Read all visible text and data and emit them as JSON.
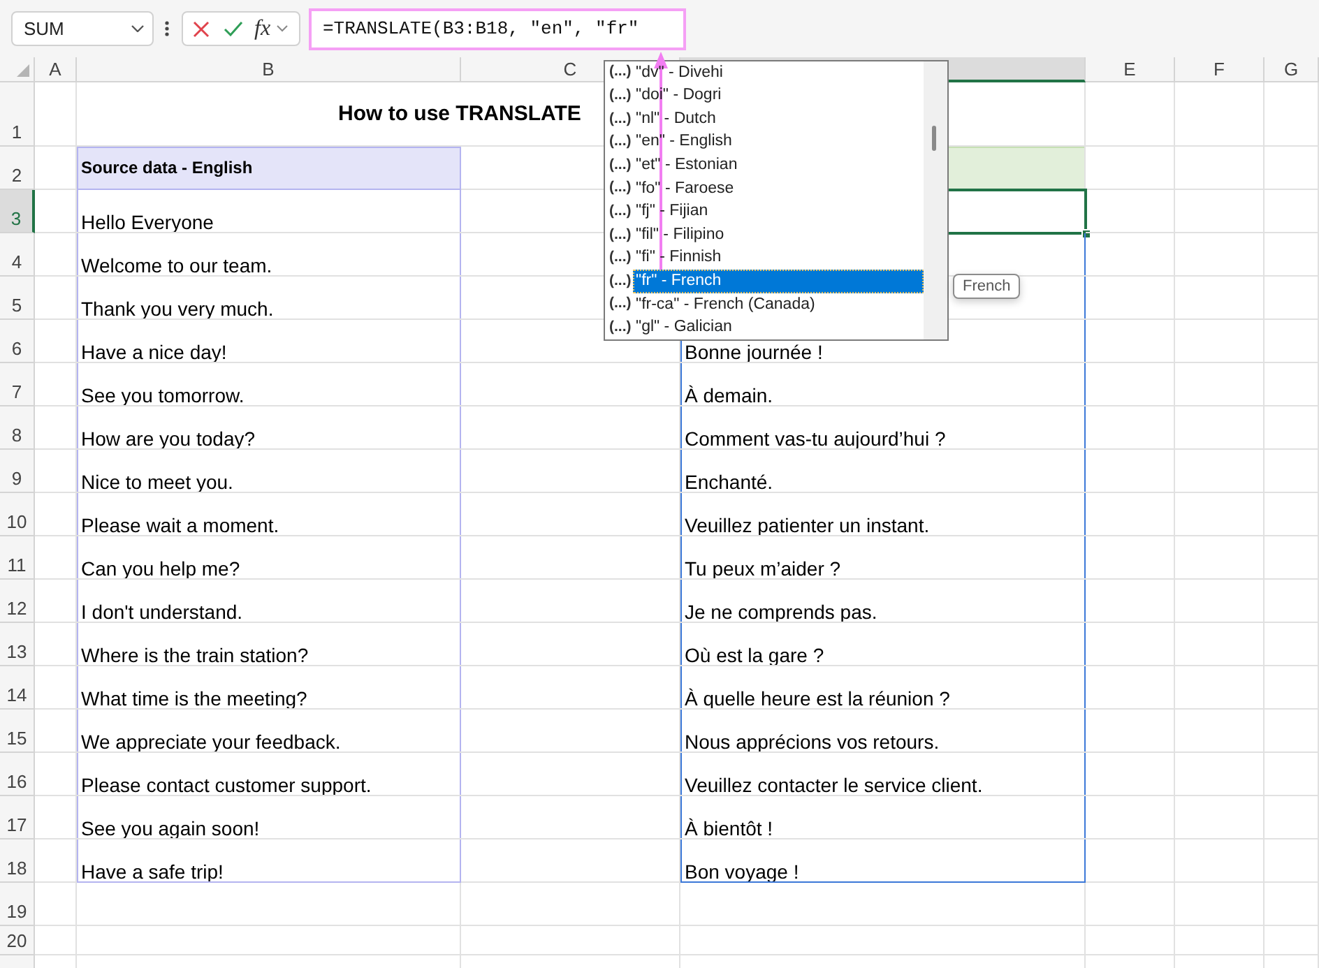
{
  "name_box": {
    "value": "SUM"
  },
  "formula_bar": {
    "function_label": "fx",
    "formula": "=TRANSLATE(B3:B18, \"en\", \"fr\""
  },
  "columns": [
    {
      "label": "A",
      "selected": false
    },
    {
      "label": "B",
      "selected": false
    },
    {
      "label": "C",
      "selected": false
    },
    {
      "selected": true
    },
    {
      "label": "E",
      "selected": false
    },
    {
      "label": "F",
      "selected": false
    },
    {
      "label": "G",
      "selected": false
    }
  ],
  "rows": [
    {
      "label": "1",
      "selected": false,
      "kind": "title",
      "title": "How to use TRANSLATE"
    },
    {
      "label": "2",
      "selected": false,
      "kind": "header",
      "source": "Source data - English"
    },
    {
      "label": "3",
      "selected": true,
      "kind": "data",
      "source": "Hello Everyone"
    },
    {
      "label": "4",
      "selected": false,
      "kind": "data",
      "source": "Welcome to our team."
    },
    {
      "label": "5",
      "selected": false,
      "kind": "data",
      "source": "Thank you very much."
    },
    {
      "label": "6",
      "selected": false,
      "kind": "data",
      "source": "Have a nice day!",
      "result": "Bonne journée !"
    },
    {
      "label": "7",
      "selected": false,
      "kind": "data",
      "source": "See you tomorrow.",
      "result": "À demain."
    },
    {
      "label": "8",
      "selected": false,
      "kind": "data",
      "source": "How are you today?",
      "result": "Comment vas-tu aujourd’hui ?"
    },
    {
      "label": "9",
      "selected": false,
      "kind": "data",
      "source": "Nice to meet you.",
      "result": "Enchanté."
    },
    {
      "label": "10",
      "selected": false,
      "kind": "data",
      "source": "Please wait a moment.",
      "result": "Veuillez patienter un instant."
    },
    {
      "label": "11",
      "selected": false,
      "kind": "data",
      "source": "Can you help me?",
      "result": "Tu peux m’aider ?"
    },
    {
      "label": "12",
      "selected": false,
      "kind": "data",
      "source": "I don't understand.",
      "result": "Je ne comprends pas."
    },
    {
      "label": "13",
      "selected": false,
      "kind": "data",
      "source": "Where is the train station?",
      "result": "Où est la gare ?"
    },
    {
      "label": "14",
      "selected": false,
      "kind": "data",
      "source": "What time is the meeting?",
      "result": "À quelle heure est la réunion ?"
    },
    {
      "label": "15",
      "selected": false,
      "kind": "data",
      "source": "We appreciate your feedback.",
      "result": "Nous apprécions vos retours."
    },
    {
      "label": "16",
      "selected": false,
      "kind": "data",
      "source": "Please contact customer support.",
      "result": "Veuillez contacter le service client."
    },
    {
      "label": "17",
      "selected": false,
      "kind": "data",
      "source": "See you again soon!",
      "result": "À bientôt !"
    },
    {
      "label": "18",
      "selected": false,
      "kind": "data",
      "source": "Have a safe trip!",
      "result": "Bon voyage !"
    },
    {
      "label": "19",
      "selected": false,
      "kind": "data"
    },
    {
      "label": "20",
      "selected": false,
      "kind": "data"
    }
  ],
  "autocomplete": {
    "items": [
      {
        "marker": "(...)",
        "text": "\"dv\" - Divehi",
        "selected": false
      },
      {
        "marker": "(...)",
        "text": "\"doi\" - Dogri",
        "selected": false
      },
      {
        "marker": "(...)",
        "text": "\"nl\" - Dutch",
        "selected": false
      },
      {
        "marker": "(...)",
        "text": "\"en\" - English",
        "selected": false
      },
      {
        "marker": "(...)",
        "text": "\"et\" - Estonian",
        "selected": false
      },
      {
        "marker": "(...)",
        "text": "\"fo\" - Faroese",
        "selected": false
      },
      {
        "marker": "(...)",
        "text": "\"fj\" - Fijian",
        "selected": false
      },
      {
        "marker": "(...)",
        "text": "\"fil\" - Filipino",
        "selected": false
      },
      {
        "marker": "(...)",
        "text": "\"fi\" - Finnish",
        "selected": false
      },
      {
        "marker": "(...)",
        "text": "\"fr\" - French",
        "selected": true
      },
      {
        "marker": "(...)",
        "text": "\"fr-ca\" - French (Canada)",
        "selected": false
      },
      {
        "marker": "(...)",
        "text": "\"gl\" - Galician",
        "selected": false
      }
    ],
    "tooltip": "French"
  }
}
